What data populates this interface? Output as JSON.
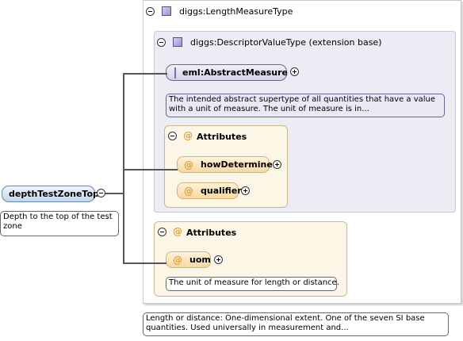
{
  "root": {
    "label": "depthTestZoneTop",
    "doc": "Depth to the top of the test zone"
  },
  "type": {
    "label": "diggs:LengthMeasureType",
    "doc": "Length or distance: One-dimensional extent. One of the seven SI base quantities. Used universally in measurement and..."
  },
  "base": {
    "label": "diggs:DescriptorValueType (extension base)"
  },
  "abstract": {
    "label": "eml:AbstractMeasure",
    "doc": "The intended abstract supertype of all quantities that have a value with a unit of measure. The unit of measure is in..."
  },
  "base_attributes": {
    "title": "Attributes",
    "items": [
      "howDetermined",
      "qualifier"
    ]
  },
  "type_attributes": {
    "title": "Attributes",
    "items": [
      "uom"
    ],
    "uom_doc": "The unit of measure for length or distance."
  },
  "icons": {
    "at": "@"
  }
}
